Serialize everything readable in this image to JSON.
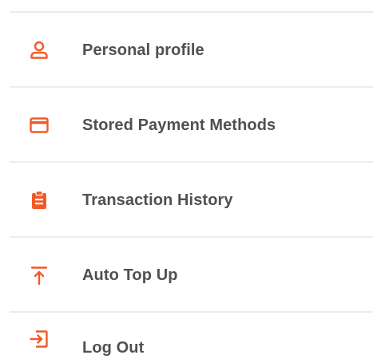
{
  "theme": {
    "accent": "#f15a29",
    "text": "#505050",
    "divider": "#ececec"
  },
  "menu": {
    "items": [
      {
        "label": "Personal profile",
        "icon": "person-icon"
      },
      {
        "label": "Stored Payment Methods",
        "icon": "credit-card-icon"
      },
      {
        "label": "Transaction History",
        "icon": "clipboard-icon"
      },
      {
        "label": "Auto Top Up",
        "icon": "arrow-up-to-line-icon"
      },
      {
        "label": "Log Out",
        "icon": "log-out-icon"
      }
    ]
  }
}
